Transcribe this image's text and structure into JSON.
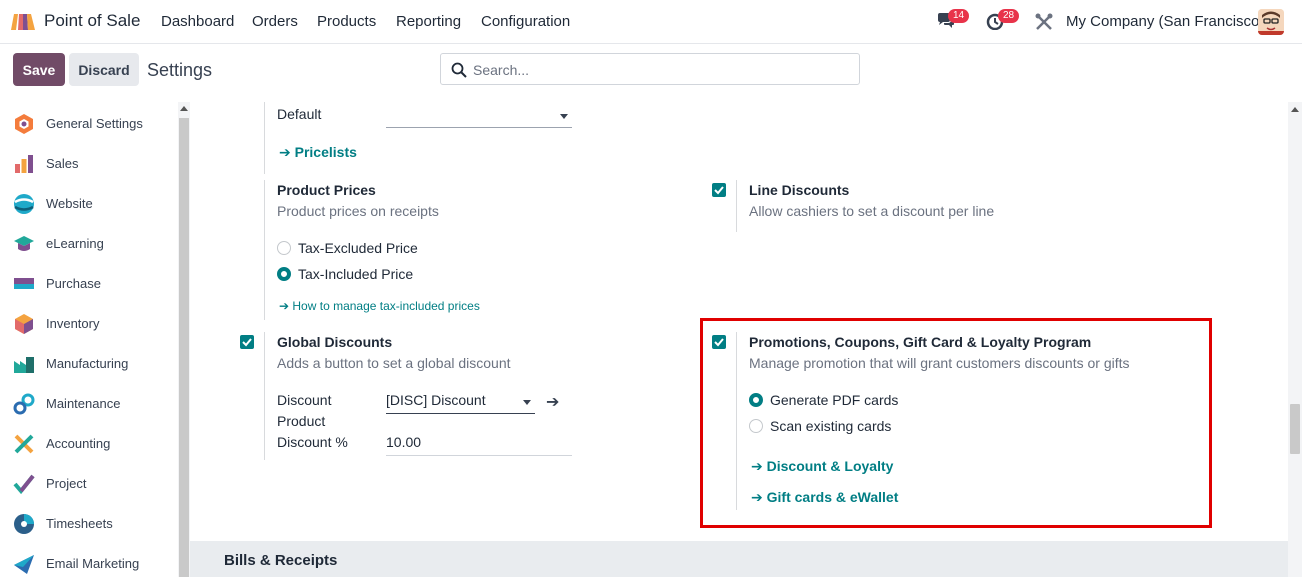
{
  "navbar": {
    "app_name": "Point of Sale",
    "menu": [
      "Dashboard",
      "Orders",
      "Products",
      "Reporting",
      "Configuration"
    ],
    "messages_count": "14",
    "activities_count": "28",
    "company": "My Company (San Francisco)"
  },
  "control_panel": {
    "save_label": "Save",
    "discard_label": "Discard",
    "title": "Settings",
    "search_placeholder": "Search..."
  },
  "sidebar": {
    "items": [
      {
        "label": "General Settings",
        "icon": "general-settings-icon"
      },
      {
        "label": "Sales",
        "icon": "sales-icon"
      },
      {
        "label": "Website",
        "icon": "website-icon"
      },
      {
        "label": "eLearning",
        "icon": "elearning-icon"
      },
      {
        "label": "Purchase",
        "icon": "purchase-icon"
      },
      {
        "label": "Inventory",
        "icon": "inventory-icon"
      },
      {
        "label": "Manufacturing",
        "icon": "manufacturing-icon"
      },
      {
        "label": "Maintenance",
        "icon": "maintenance-icon"
      },
      {
        "label": "Accounting",
        "icon": "accounting-icon"
      },
      {
        "label": "Project",
        "icon": "project-icon"
      },
      {
        "label": "Timesheets",
        "icon": "timesheets-icon"
      },
      {
        "label": "Email Marketing",
        "icon": "email-marketing-icon"
      }
    ]
  },
  "main": {
    "pricelist": {
      "default_value": "Default",
      "link": "Pricelists"
    },
    "product_prices": {
      "title": "Product Prices",
      "desc": "Product prices on receipts",
      "options": [
        "Tax-Excluded Price",
        "Tax-Included Price"
      ],
      "selected": "Tax-Included Price",
      "link": "How to manage tax-included prices"
    },
    "line_discounts": {
      "title": "Line Discounts",
      "desc": "Allow cashiers to set a discount per line",
      "checked": true
    },
    "global_discounts": {
      "title": "Global Discounts",
      "desc": "Adds a button to set a global discount",
      "checked": true,
      "product_label_1": "Discount",
      "product_label_2": "Product",
      "product_value": "[DISC] Discount",
      "percent_label": "Discount %",
      "percent_value": "10.00"
    },
    "promotions": {
      "title": "Promotions, Coupons, Gift Card & Loyalty Program",
      "desc": "Manage promotion that will grant customers discounts or gifts",
      "checked": true,
      "options": [
        "Generate PDF cards",
        "Scan existing cards"
      ],
      "selected": "Generate PDF cards",
      "link_1": "Discount & Loyalty",
      "link_2": "Gift cards & eWallet"
    },
    "section_title": "Bills & Receipts"
  },
  "colors": {
    "brand": "#714b67",
    "accent": "#017e84",
    "highlight": "#e00000"
  }
}
